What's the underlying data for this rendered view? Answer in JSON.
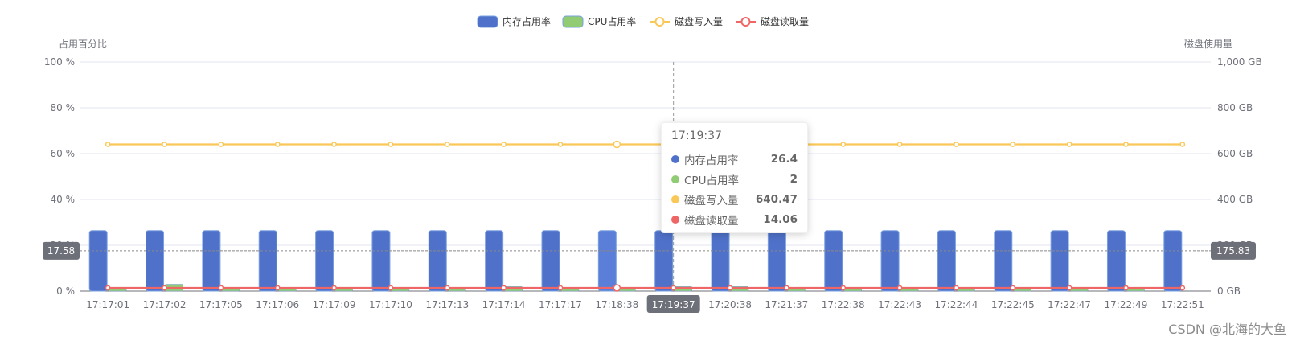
{
  "chart_data": {
    "type": "bar",
    "categories": [
      "17:17:01",
      "17:17:02",
      "17:17:05",
      "17:17:06",
      "17:17:09",
      "17:17:10",
      "17:17:13",
      "17:17:14",
      "17:17:17",
      "17:18:38",
      "17:19:37",
      "17:20:38",
      "17:21:37",
      "17:22:38",
      "17:22:43",
      "17:22:44",
      "17:22:45",
      "17:22:47",
      "17:22:49",
      "17:22:51"
    ],
    "series": [
      {
        "name": "内存占用率",
        "type": "bar",
        "axis": "left",
        "color": "#4f71c9",
        "values": [
          26.4,
          26.4,
          26.4,
          26.4,
          26.4,
          26.4,
          26.4,
          26.4,
          26.4,
          26.4,
          26.4,
          26.4,
          26.4,
          26.4,
          26.4,
          26.4,
          26.4,
          26.4,
          26.4,
          26.4
        ]
      },
      {
        "name": "CPU占用率",
        "type": "bar",
        "axis": "left",
        "color": "#91cc75",
        "values": [
          1,
          3,
          1,
          1,
          1,
          1,
          1,
          2,
          1,
          1,
          2,
          2,
          1,
          1,
          1,
          1,
          1,
          1,
          1,
          0
        ]
      },
      {
        "name": "磁盘写入量",
        "type": "line",
        "axis": "right",
        "color": "#fac858",
        "values": [
          640.47,
          640.47,
          640.47,
          640.47,
          640.47,
          640.47,
          640.47,
          640.47,
          640.47,
          640.47,
          640.47,
          640.47,
          640.47,
          640.47,
          640.47,
          640.47,
          640.47,
          640.47,
          640.47,
          640.47
        ]
      },
      {
        "name": "磁盘读取量",
        "type": "line",
        "axis": "right",
        "color": "#ee6666",
        "values": [
          14.06,
          14.06,
          14.06,
          14.06,
          14.06,
          14.06,
          14.06,
          14.06,
          14.06,
          14.06,
          14.06,
          14.06,
          14.06,
          14.06,
          14.06,
          14.06,
          14.06,
          14.06,
          14.06,
          14.06
        ]
      }
    ],
    "y_left": {
      "name": "占用百分比",
      "ylim": [
        0,
        100
      ],
      "ticks": [
        "0 %",
        "20 %",
        "40 %",
        "60 %",
        "80 %",
        "100 %"
      ]
    },
    "y_right": {
      "name": "磁盘使用量",
      "ylim": [
        0,
        1000
      ],
      "ticks": [
        "0 GB",
        "200 GB",
        "400 GB",
        "600 GB",
        "800 GB",
        "1,000 GB"
      ]
    },
    "legend_position": "top-center",
    "grid": true,
    "crosshair": {
      "x_label": "17:19:37",
      "left_label": "17.58",
      "right_label": "175.83",
      "y_value_percent": 17.58
    }
  },
  "tooltip": {
    "title": "17:19:37",
    "rows": [
      {
        "name": "内存占用率",
        "value": "26.4",
        "color": "#4f71c9"
      },
      {
        "name": "CPU占用率",
        "value": "2",
        "color": "#91cc75"
      },
      {
        "name": "磁盘写入量",
        "value": "640.47",
        "color": "#fac858"
      },
      {
        "name": "磁盘读取量",
        "value": "14.06",
        "color": "#ee6666"
      }
    ]
  },
  "watermark": "CSDN @北海的大鱼"
}
